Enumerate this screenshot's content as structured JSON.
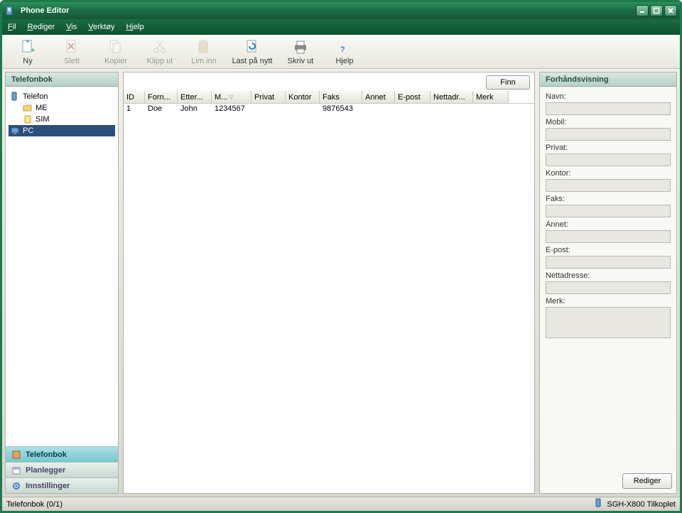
{
  "window": {
    "title": "Phone Editor"
  },
  "menu": {
    "fil": "Fil",
    "rediger": "Rediger",
    "vis": "Vis",
    "verktoy": "Verktøy",
    "hjelp": "Hjelp"
  },
  "toolbar": {
    "ny": "Ny",
    "slett": "Slett",
    "kopier": "Kopier",
    "klipp": "Klipp ut",
    "lim": "Lim inn",
    "last": "Last på nytt",
    "skriv": "Skriv ut",
    "hjelp": "Hjelp"
  },
  "left": {
    "header": "Telefonbok",
    "tree": {
      "telefon": "Telefon",
      "me": "ME",
      "sim": "SIM",
      "pc": "PC"
    },
    "nav": {
      "telefonbok": "Telefonbok",
      "planlegger": "Planlegger",
      "innstillinger": "Innstillinger"
    }
  },
  "center": {
    "find": "Finn",
    "columns": {
      "id": "ID",
      "forn": "Forn...",
      "etter": "Etter...",
      "mob": "M...",
      "priv": "Privat",
      "kont": "Kontor",
      "faks": "Faks",
      "annet": "Annet",
      "epost": "E-post",
      "nett": "Nettadr...",
      "merk": "Merk"
    },
    "rows": [
      {
        "id": "1",
        "forn": "Doe",
        "etter": "John",
        "mob": "1234567",
        "priv": "",
        "kont": "",
        "faks": "9876543",
        "annet": "",
        "epost": "",
        "nett": "",
        "merk": ""
      }
    ]
  },
  "right": {
    "header": "Forhåndsvisning",
    "labels": {
      "navn": "Navn:",
      "mobil": "Mobil:",
      "privat": "Privat:",
      "kontor": "Kontor:",
      "faks": "Faks:",
      "annet": "Annet:",
      "epost": "E-post:",
      "nett": "Nettadresse:",
      "merk": "Merk:"
    },
    "edit": "Rediger"
  },
  "status": {
    "left": "Telefonbok (0/1)",
    "right": "SGH-X800 Tilkoplet"
  }
}
